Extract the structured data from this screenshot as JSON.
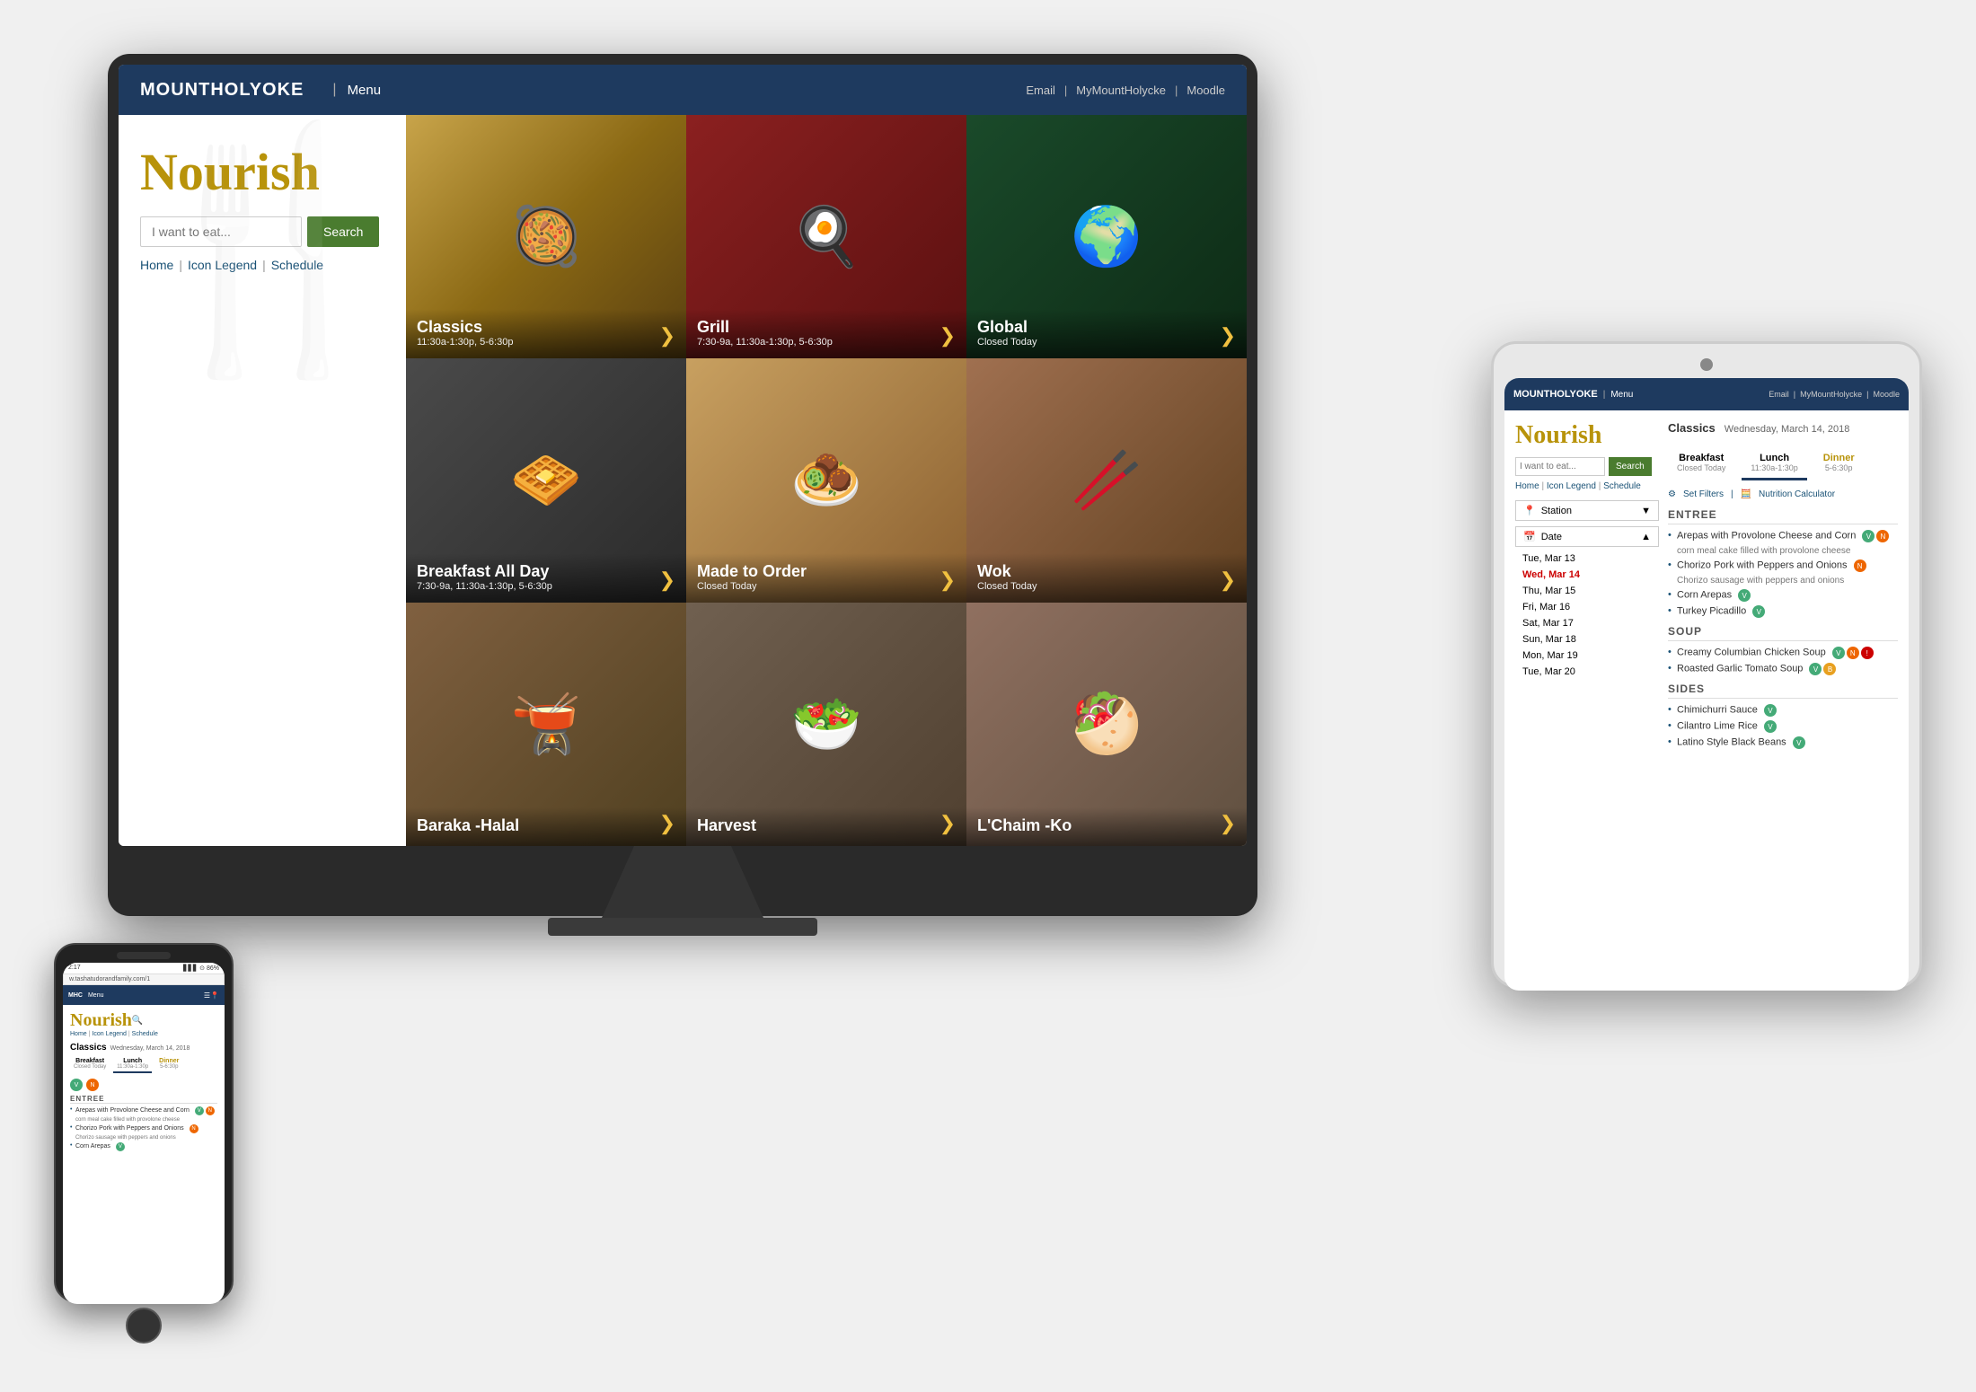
{
  "monitor": {
    "nav": {
      "logo": "MOUNTHOLYOKE",
      "logo_h": "H",
      "menu": "Menu",
      "links": [
        "Email",
        "MyMountHolycke",
        "Moodle"
      ],
      "separators": [
        "|",
        "|"
      ]
    },
    "sidebar": {
      "title": "Nourish",
      "search_placeholder": "I want to eat...",
      "search_button": "Search",
      "links": [
        "Home",
        "Icon Legend",
        "Schedule"
      ],
      "link_separators": [
        "|",
        "|"
      ]
    },
    "grid": [
      {
        "id": "classics",
        "name": "Classics",
        "hours": "11:30a-1:30p, 5-6:30p",
        "arrow": "❯",
        "closed": false
      },
      {
        "id": "grill",
        "name": "Grill",
        "hours": "7:30-9a, 11:30a-1:30p, 5-6:30p",
        "arrow": "❯",
        "closed": false
      },
      {
        "id": "global",
        "name": "Global",
        "hours": "Closed Today",
        "arrow": "❯",
        "closed": true
      },
      {
        "id": "breakfast",
        "name": "Breakfast All Day",
        "hours": "7:30-9a, 11:30a-1:30p, 5-6:30p",
        "arrow": "❯",
        "closed": false
      },
      {
        "id": "madetoorder",
        "name": "Made to Order",
        "hours": "Closed Today",
        "arrow": "❯",
        "closed": true
      },
      {
        "id": "wok",
        "name": "Wok",
        "hours": "Closed Today",
        "arrow": "❯",
        "closed": true
      },
      {
        "id": "baraka",
        "name": "Baraka -Halal",
        "hours": "",
        "arrow": "❯",
        "closed": false
      },
      {
        "id": "harvest",
        "name": "Harvest",
        "hours": "",
        "arrow": "❯",
        "closed": false
      },
      {
        "id": "lchaim",
        "name": "L'Chaim -Ko",
        "hours": "",
        "arrow": "❯",
        "closed": false
      }
    ]
  },
  "tablet": {
    "nav": {
      "logo": "MOUNTHOLYOKE",
      "menu": "Menu",
      "links": [
        "Email",
        "MyMountHolycke",
        "Moodle"
      ]
    },
    "nourish": "Nourish",
    "search_placeholder": "I want to eat...",
    "search_button": "Search",
    "links": [
      "Home",
      "Icon Legend",
      "Schedule"
    ],
    "section_title": "Classics",
    "section_date": "Wednesday, March 14, 2018",
    "tabs": [
      {
        "label": "Breakfast",
        "sub": "Closed Today",
        "active": false
      },
      {
        "label": "Lunch",
        "sub": "11:30a-1:30p",
        "active": true
      },
      {
        "label": "Dinner",
        "sub": "5-6:30p",
        "active": false,
        "highlight": true
      }
    ],
    "station_label": "Station",
    "date_label": "Date",
    "dates": [
      {
        "day": "Tue, Mar 13",
        "active": false
      },
      {
        "day": "Wed, Mar 14",
        "active": true
      },
      {
        "day": "Thu, Mar 15",
        "active": false
      },
      {
        "day": "Fri, Mar 16",
        "active": false
      },
      {
        "day": "Sat, Mar 17",
        "active": false
      },
      {
        "day": "Sun, Mar 18",
        "active": false
      },
      {
        "day": "Mon, Mar 19",
        "active": false
      },
      {
        "day": "Tue, Mar 20",
        "active": false
      }
    ],
    "filters": [
      "Set Filters",
      "Nutrition Calculator"
    ],
    "entree": {
      "header": "ENTREE",
      "items": [
        {
          "name": "Arepas with Provolone Cheese and Corn",
          "desc": "corn meal cake filled with provolone cheese",
          "icons": [
            "v",
            "n"
          ]
        },
        {
          "name": "Chorizo Pork with Peppers and Onions",
          "desc": "Chorizo sausage with peppers and onions",
          "icons": [
            "n"
          ]
        },
        {
          "name": "Corn Arepas",
          "desc": "",
          "icons": [
            "v"
          ]
        },
        {
          "name": "Turkey Picadillo",
          "desc": "",
          "icons": [
            "vegan"
          ]
        }
      ]
    },
    "soup": {
      "header": "SOUP",
      "items": [
        {
          "name": "Creamy Columbian Chicken Soup",
          "icons": [
            "v",
            "n",
            "x"
          ]
        },
        {
          "name": "Roasted Garlic Tomato Soup",
          "icons": [
            "v",
            "b"
          ]
        }
      ]
    },
    "sides": {
      "header": "SIDES",
      "items": [
        {
          "name": "Chimichurri Sauce",
          "icons": [
            "v"
          ]
        },
        {
          "name": "Cilantro Lime Rice",
          "icons": [
            "v"
          ]
        },
        {
          "name": "Latino Style Black Beans",
          "icons": [
            "vegan"
          ]
        }
      ]
    }
  },
  "phone": {
    "url": "w.tashatudorandfamily.com/1",
    "status_time": "2:17",
    "battery": "86%",
    "nav_logo": "MHC",
    "nav_menu": "Menu",
    "nourish": "Nourish",
    "links": [
      "Home",
      "Icon Legend",
      "Schedule"
    ],
    "section_title": "Classics",
    "section_date": "Wednesday, March 14, 2018",
    "tabs": [
      {
        "label": "Breakfast",
        "sub": "Closed Today"
      },
      {
        "label": "Lunch",
        "sub": "11:30a-1:30p"
      },
      {
        "label": "Dinner",
        "sub": "5-6:30p"
      }
    ],
    "entree_header": "ENTREE",
    "entree_items": [
      {
        "name": "Arepas with Provolone Cheese and Corn",
        "icons": [
          "v",
          "n"
        ]
      },
      {
        "name": "corn meal cake filled with provolone cheese"
      },
      {
        "name": "Chorizo Pork with Peppers and Onions",
        "icons": [
          "n"
        ]
      },
      {
        "name": "Chorizo sausage with peppers and onions"
      },
      {
        "name": "Corn Arepas",
        "icons": [
          "v"
        ]
      }
    ]
  },
  "extra_detections": {
    "station": "Station",
    "breakfast_closed": "Breakfast Closed"
  }
}
